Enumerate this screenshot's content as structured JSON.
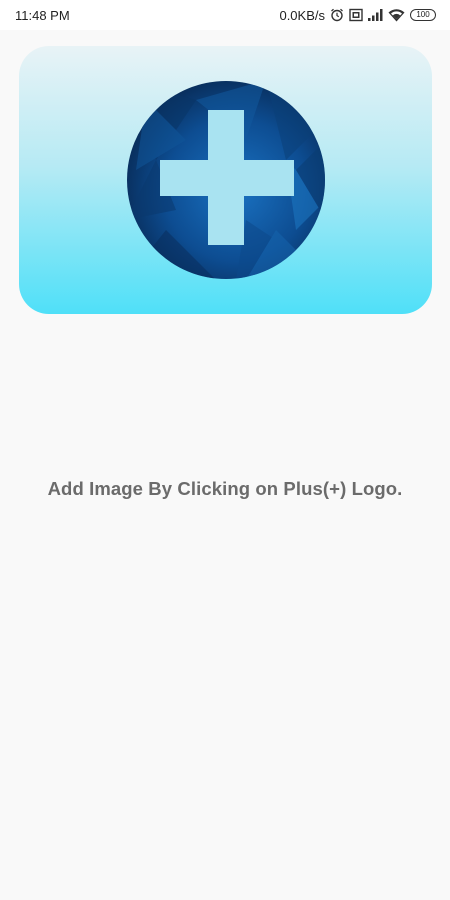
{
  "status_bar": {
    "time": "11:48 PM",
    "network_speed": "0.0KB/s",
    "battery_level": "100",
    "icons": [
      "alarm-icon",
      "sim-icon",
      "signal-icon",
      "wifi-icon",
      "battery-icon"
    ]
  },
  "header": {
    "logo_icon": "plus-icon",
    "gradient_top": "#e8f3f6",
    "gradient_bottom": "#4fe0f8",
    "logo_circle_color": "#0d3f78"
  },
  "main": {
    "message": "Add Image By Clicking on Plus(+) Logo."
  }
}
